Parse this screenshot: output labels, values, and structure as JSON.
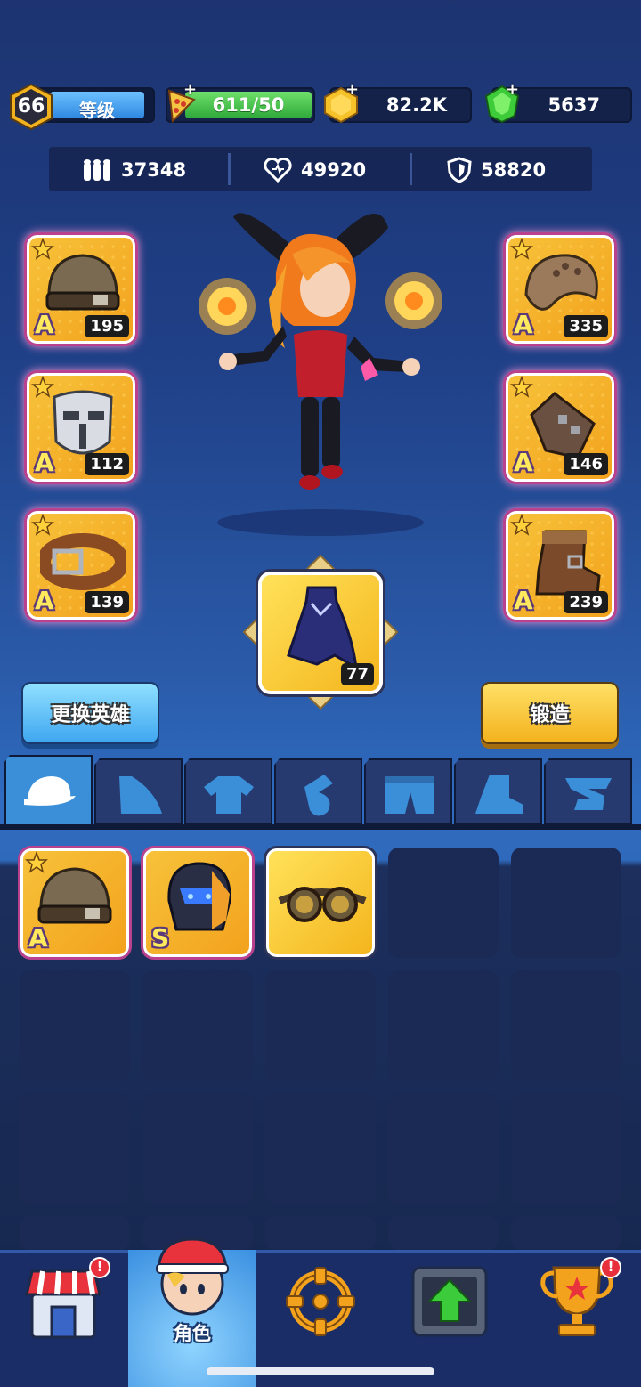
{
  "player": {
    "level": "66",
    "level_label": "等级"
  },
  "resources": {
    "energy": "611/50",
    "coins": "82.2K",
    "gems": "5637"
  },
  "stats": {
    "attack": "37348",
    "health": "49920",
    "defense": "58820"
  },
  "equipped": {
    "helmet": {
      "grade": "A",
      "level": "195",
      "icon": "helmet-icon"
    },
    "mask": {
      "grade": "A",
      "level": "112",
      "icon": "mask-icon"
    },
    "belt": {
      "grade": "A",
      "level": "139",
      "icon": "belt-icon"
    },
    "shoulder": {
      "grade": "A",
      "level": "335",
      "icon": "shoulder-pad-icon"
    },
    "gloves": {
      "grade": "A",
      "level": "146",
      "icon": "glove-icon"
    },
    "boots": {
      "grade": "A",
      "level": "239",
      "icon": "boot-icon"
    },
    "cape": {
      "level": "77",
      "icon": "cape-icon"
    }
  },
  "buttons": {
    "change_hero": "更换英雄",
    "forge": "锻造"
  },
  "tabs": [
    "hat-icon",
    "cape-icon",
    "shirt-icon",
    "glove-icon",
    "pants-icon",
    "boot-icon",
    "belt-icon"
  ],
  "inventory": [
    {
      "grade": "A",
      "icon": "helmet-icon"
    },
    {
      "grade": "S",
      "icon": "robot-helmet-icon"
    },
    {
      "grade": "",
      "icon": "goggles-icon"
    }
  ],
  "nav": {
    "shop": "shop-icon",
    "character": "角色",
    "target": "crosshair-icon",
    "upgrade": "upgrade-icon",
    "trophy": "trophy-icon",
    "alert": "!"
  },
  "colors": {
    "accent_blue": "#3a8fd8",
    "gold": "#f3b21d",
    "rarity_pink": "#b9418e"
  }
}
